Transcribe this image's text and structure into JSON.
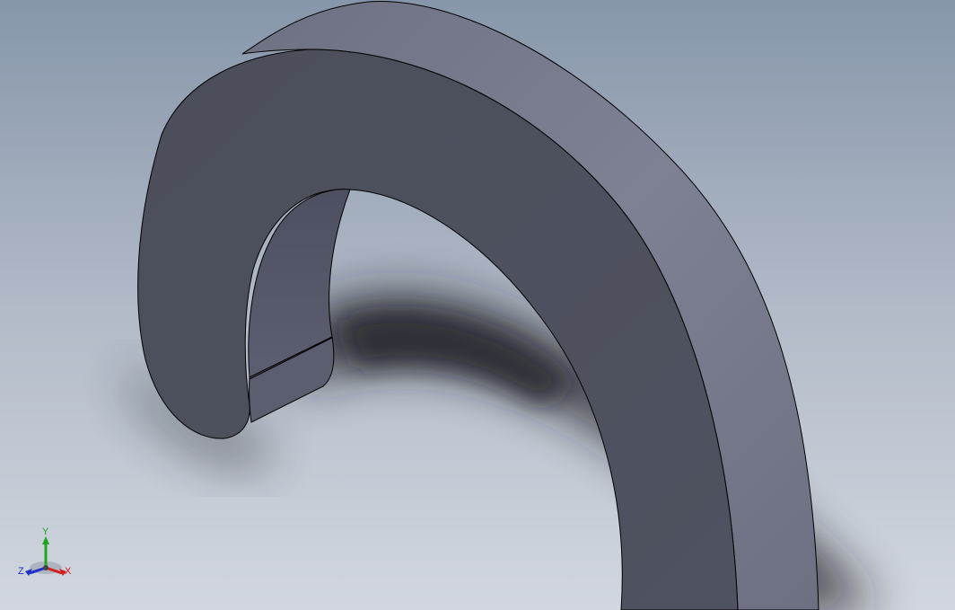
{
  "colors": {
    "background_top": "#8b98ab",
    "background_bottom": "#d0d5de",
    "face_front": "#4d505d",
    "face_outer_rim": "#787c8d",
    "face_end_cut": "#5d6071",
    "edge_line": "#000000",
    "axis_x": "#d12020",
    "axis_y": "#1fa51f",
    "axis_z": "#1f2fc8"
  },
  "triad": {
    "x_label": "X",
    "y_label": "Y",
    "z_label": "Z"
  }
}
